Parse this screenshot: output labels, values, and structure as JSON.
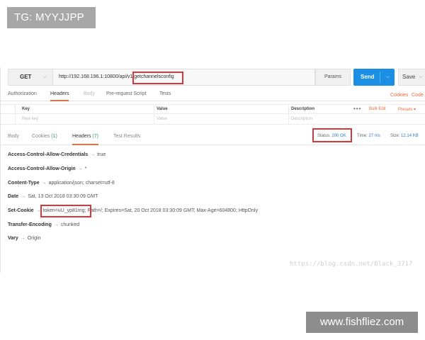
{
  "watermarks": {
    "top": "TG: MYYJJPP",
    "bottom": "www.fishfliez.com",
    "blog": "https://blog.csdn.net/Black_3717"
  },
  "request": {
    "method": "GET",
    "url": "http://192.168.196.1:10800/api/v1/getchannelsconfig",
    "params_label": "Params",
    "send_label": "Send",
    "save_label": "Save"
  },
  "request_tabs": {
    "authorization": "Authorization",
    "headers": "Headers",
    "body": "Body",
    "prerequest": "Pre-request Script",
    "tests": "Tests",
    "cookies": "Cookies",
    "code": "Code"
  },
  "kv_table": {
    "key_header": "Key",
    "value_header": "Value",
    "description_header": "Description",
    "bulk_edit": "Bulk Edit",
    "presets": "Presets ▾",
    "key_placeholder": "New key",
    "value_placeholder": "Value",
    "description_placeholder": "Description"
  },
  "response_tabs": {
    "body": "Body",
    "cookies": "Cookies",
    "cookies_count": "(1)",
    "headers": "Headers",
    "headers_count": "(7)",
    "test_results": "Test Results"
  },
  "status": {
    "status_label": "Status:",
    "status_value": "200 OK",
    "time_label": "Time:",
    "time_value": "27 ms",
    "size_label": "Size:",
    "size_value": "12.14 KB"
  },
  "headers": [
    {
      "key": "Access-Control-Allow-Credentials",
      "value": "true"
    },
    {
      "key": "Access-Control-Allow-Origin",
      "value": "*"
    },
    {
      "key": "Content-Type",
      "value": "application/json; charset=utf-8"
    },
    {
      "key": "Date",
      "value": "Sat, 13 Oct 2018 03:30:09 GMT"
    },
    {
      "key": "Set-Cookie",
      "value": "token=uU_yp81mg; Path=/; Expires=Sat, 20 Oct 2018 03:30:09 GMT; Max-Age=604800; HttpOnly"
    },
    {
      "key": "Transfer-Encoding",
      "value": "chunked"
    },
    {
      "key": "Vary",
      "value": "Origin"
    }
  ],
  "arrow": "→",
  "colors": {
    "accent": "#f26b3a",
    "send": "#1a8fe3",
    "highlight": "#d9383a",
    "status_ok": "#2a7bd6"
  }
}
